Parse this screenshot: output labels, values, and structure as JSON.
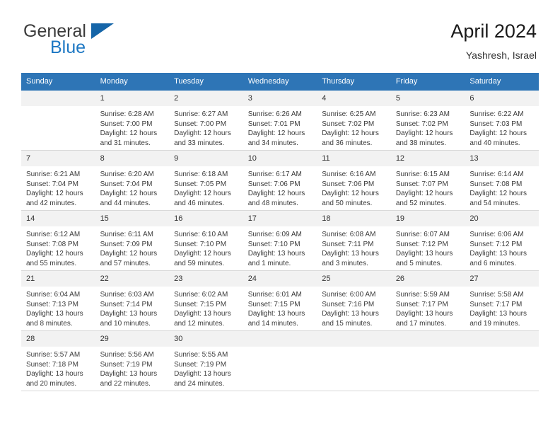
{
  "brand": {
    "name_part1": "General",
    "name_part2": "Blue",
    "logo_icon": "blue-triangle-logo"
  },
  "header": {
    "title": "April 2024",
    "subtitle": "Yashresh, Israel"
  },
  "calendar": {
    "weekday_headers": [
      "Sunday",
      "Monday",
      "Tuesday",
      "Wednesday",
      "Thursday",
      "Friday",
      "Saturday"
    ],
    "colors": {
      "header_bg": "#2e75b6",
      "header_text": "#ffffff",
      "daynum_bg": "#f2f2f2",
      "row_border": "#2e75b6",
      "brand_blue": "#1c77c3"
    },
    "weeks": [
      [
        {
          "day": "",
          "blank": true,
          "sunrise": "",
          "sunset": "",
          "daylight1": "",
          "daylight2": ""
        },
        {
          "day": "1",
          "sunrise": "Sunrise: 6:28 AM",
          "sunset": "Sunset: 7:00 PM",
          "daylight1": "Daylight: 12 hours",
          "daylight2": "and 31 minutes."
        },
        {
          "day": "2",
          "sunrise": "Sunrise: 6:27 AM",
          "sunset": "Sunset: 7:00 PM",
          "daylight1": "Daylight: 12 hours",
          "daylight2": "and 33 minutes."
        },
        {
          "day": "3",
          "sunrise": "Sunrise: 6:26 AM",
          "sunset": "Sunset: 7:01 PM",
          "daylight1": "Daylight: 12 hours",
          "daylight2": "and 34 minutes."
        },
        {
          "day": "4",
          "sunrise": "Sunrise: 6:25 AM",
          "sunset": "Sunset: 7:02 PM",
          "daylight1": "Daylight: 12 hours",
          "daylight2": "and 36 minutes."
        },
        {
          "day": "5",
          "sunrise": "Sunrise: 6:23 AM",
          "sunset": "Sunset: 7:02 PM",
          "daylight1": "Daylight: 12 hours",
          "daylight2": "and 38 minutes."
        },
        {
          "day": "6",
          "sunrise": "Sunrise: 6:22 AM",
          "sunset": "Sunset: 7:03 PM",
          "daylight1": "Daylight: 12 hours",
          "daylight2": "and 40 minutes."
        }
      ],
      [
        {
          "day": "7",
          "sunrise": "Sunrise: 6:21 AM",
          "sunset": "Sunset: 7:04 PM",
          "daylight1": "Daylight: 12 hours",
          "daylight2": "and 42 minutes."
        },
        {
          "day": "8",
          "sunrise": "Sunrise: 6:20 AM",
          "sunset": "Sunset: 7:04 PM",
          "daylight1": "Daylight: 12 hours",
          "daylight2": "and 44 minutes."
        },
        {
          "day": "9",
          "sunrise": "Sunrise: 6:18 AM",
          "sunset": "Sunset: 7:05 PM",
          "daylight1": "Daylight: 12 hours",
          "daylight2": "and 46 minutes."
        },
        {
          "day": "10",
          "sunrise": "Sunrise: 6:17 AM",
          "sunset": "Sunset: 7:06 PM",
          "daylight1": "Daylight: 12 hours",
          "daylight2": "and 48 minutes."
        },
        {
          "day": "11",
          "sunrise": "Sunrise: 6:16 AM",
          "sunset": "Sunset: 7:06 PM",
          "daylight1": "Daylight: 12 hours",
          "daylight2": "and 50 minutes."
        },
        {
          "day": "12",
          "sunrise": "Sunrise: 6:15 AM",
          "sunset": "Sunset: 7:07 PM",
          "daylight1": "Daylight: 12 hours",
          "daylight2": "and 52 minutes."
        },
        {
          "day": "13",
          "sunrise": "Sunrise: 6:14 AM",
          "sunset": "Sunset: 7:08 PM",
          "daylight1": "Daylight: 12 hours",
          "daylight2": "and 54 minutes."
        }
      ],
      [
        {
          "day": "14",
          "sunrise": "Sunrise: 6:12 AM",
          "sunset": "Sunset: 7:08 PM",
          "daylight1": "Daylight: 12 hours",
          "daylight2": "and 55 minutes."
        },
        {
          "day": "15",
          "sunrise": "Sunrise: 6:11 AM",
          "sunset": "Sunset: 7:09 PM",
          "daylight1": "Daylight: 12 hours",
          "daylight2": "and 57 minutes."
        },
        {
          "day": "16",
          "sunrise": "Sunrise: 6:10 AM",
          "sunset": "Sunset: 7:10 PM",
          "daylight1": "Daylight: 12 hours",
          "daylight2": "and 59 minutes."
        },
        {
          "day": "17",
          "sunrise": "Sunrise: 6:09 AM",
          "sunset": "Sunset: 7:10 PM",
          "daylight1": "Daylight: 13 hours",
          "daylight2": "and 1 minute."
        },
        {
          "day": "18",
          "sunrise": "Sunrise: 6:08 AM",
          "sunset": "Sunset: 7:11 PM",
          "daylight1": "Daylight: 13 hours",
          "daylight2": "and 3 minutes."
        },
        {
          "day": "19",
          "sunrise": "Sunrise: 6:07 AM",
          "sunset": "Sunset: 7:12 PM",
          "daylight1": "Daylight: 13 hours",
          "daylight2": "and 5 minutes."
        },
        {
          "day": "20",
          "sunrise": "Sunrise: 6:06 AM",
          "sunset": "Sunset: 7:12 PM",
          "daylight1": "Daylight: 13 hours",
          "daylight2": "and 6 minutes."
        }
      ],
      [
        {
          "day": "21",
          "sunrise": "Sunrise: 6:04 AM",
          "sunset": "Sunset: 7:13 PM",
          "daylight1": "Daylight: 13 hours",
          "daylight2": "and 8 minutes."
        },
        {
          "day": "22",
          "sunrise": "Sunrise: 6:03 AM",
          "sunset": "Sunset: 7:14 PM",
          "daylight1": "Daylight: 13 hours",
          "daylight2": "and 10 minutes."
        },
        {
          "day": "23",
          "sunrise": "Sunrise: 6:02 AM",
          "sunset": "Sunset: 7:15 PM",
          "daylight1": "Daylight: 13 hours",
          "daylight2": "and 12 minutes."
        },
        {
          "day": "24",
          "sunrise": "Sunrise: 6:01 AM",
          "sunset": "Sunset: 7:15 PM",
          "daylight1": "Daylight: 13 hours",
          "daylight2": "and 14 minutes."
        },
        {
          "day": "25",
          "sunrise": "Sunrise: 6:00 AM",
          "sunset": "Sunset: 7:16 PM",
          "daylight1": "Daylight: 13 hours",
          "daylight2": "and 15 minutes."
        },
        {
          "day": "26",
          "sunrise": "Sunrise: 5:59 AM",
          "sunset": "Sunset: 7:17 PM",
          "daylight1": "Daylight: 13 hours",
          "daylight2": "and 17 minutes."
        },
        {
          "day": "27",
          "sunrise": "Sunrise: 5:58 AM",
          "sunset": "Sunset: 7:17 PM",
          "daylight1": "Daylight: 13 hours",
          "daylight2": "and 19 minutes."
        }
      ],
      [
        {
          "day": "28",
          "sunrise": "Sunrise: 5:57 AM",
          "sunset": "Sunset: 7:18 PM",
          "daylight1": "Daylight: 13 hours",
          "daylight2": "and 20 minutes."
        },
        {
          "day": "29",
          "sunrise": "Sunrise: 5:56 AM",
          "sunset": "Sunset: 7:19 PM",
          "daylight1": "Daylight: 13 hours",
          "daylight2": "and 22 minutes."
        },
        {
          "day": "30",
          "sunrise": "Sunrise: 5:55 AM",
          "sunset": "Sunset: 7:19 PM",
          "daylight1": "Daylight: 13 hours",
          "daylight2": "and 24 minutes."
        },
        {
          "day": "",
          "blank": true,
          "sunrise": "",
          "sunset": "",
          "daylight1": "",
          "daylight2": ""
        },
        {
          "day": "",
          "blank": true,
          "sunrise": "",
          "sunset": "",
          "daylight1": "",
          "daylight2": ""
        },
        {
          "day": "",
          "blank": true,
          "sunrise": "",
          "sunset": "",
          "daylight1": "",
          "daylight2": ""
        },
        {
          "day": "",
          "blank": true,
          "sunrise": "",
          "sunset": "",
          "daylight1": "",
          "daylight2": ""
        }
      ]
    ]
  }
}
